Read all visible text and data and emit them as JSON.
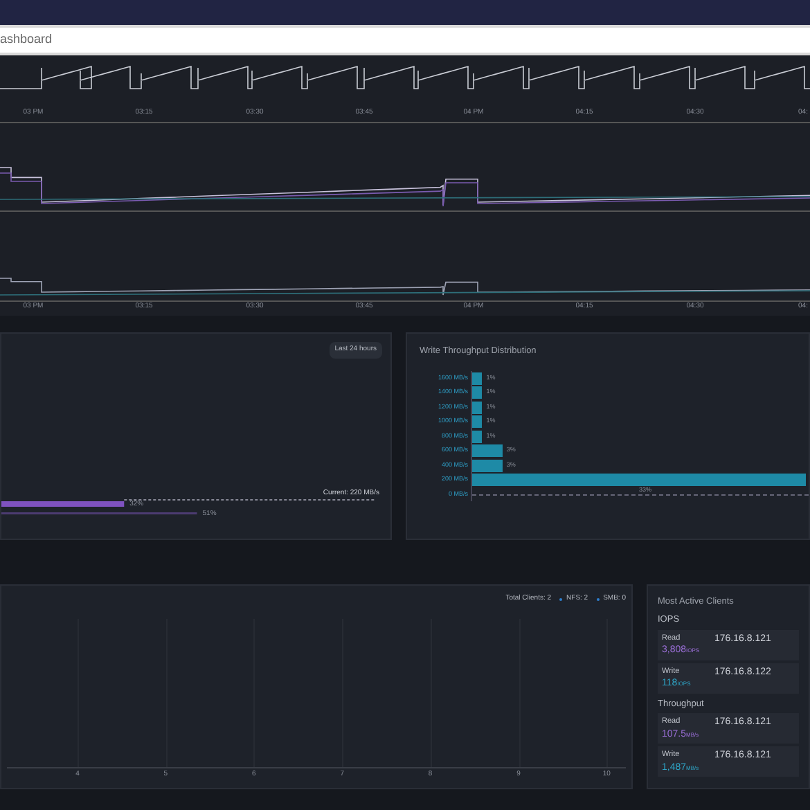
{
  "address_bar": {
    "value": "ashboard"
  },
  "timeline": {
    "top_axis": [
      "03 PM",
      "03:15",
      "03:30",
      "03:45",
      "04 PM",
      "04:15",
      "04:30",
      "04:"
    ],
    "bottom_axis": [
      "03 PM",
      "03:15",
      "03:30",
      "03:45",
      "04 PM",
      "04:15",
      "04:30",
      "04:"
    ]
  },
  "distribution_panel": {
    "range_button": "Last 24 hours",
    "current_label": "Current: 220 MB/s",
    "bars": [
      {
        "level": 0.32,
        "reading": "32%"
      },
      {
        "level": 0.51,
        "reading": "51%"
      }
    ]
  },
  "write_distribution": {
    "chart_data": {
      "type": "bar",
      "orientation": "horizontal",
      "title": "Write Throughput Distribution",
      "categories": [
        "1600 MB/s",
        "1400 MB/s",
        "1200 MB/s",
        "1000 MB/s",
        "800 MB/s",
        "600 MB/s",
        "400 MB/s",
        "200 MB/s",
        "0 MB/s"
      ],
      "values": [
        1,
        1,
        1,
        1,
        1,
        3,
        3,
        33,
        null
      ],
      "value_labels": [
        "1%",
        "1%",
        "1%",
        "1%",
        "1%",
        "3%",
        "3%",
        "33%",
        null
      ]
    }
  },
  "clients_panel": {
    "total": "Total Clients: 2",
    "legend": [
      "NFS: 2",
      "SMB: 0"
    ],
    "x_ticks": [
      "4",
      "5",
      "6",
      "7",
      "8",
      "9",
      "10"
    ]
  },
  "active_clients": {
    "title": "Most Active Clients",
    "groups": [
      {
        "title": "IOPS",
        "rows": [
          {
            "kind": "read",
            "label": "Read",
            "value": "3,808",
            "unit": "IOPS",
            "client": "176.16.8.121"
          },
          {
            "kind": "write",
            "label": "Write",
            "value": "118",
            "unit": "IOPS",
            "client": "176.16.8.122"
          }
        ]
      },
      {
        "title": "Throughput",
        "rows": [
          {
            "kind": "read",
            "label": "Read",
            "value": "107.5",
            "unit": "MB/s",
            "client": "176.16.8.121"
          },
          {
            "kind": "write",
            "label": "Write",
            "value": "1,487",
            "unit": "MB/s",
            "client": "176.16.8.121"
          }
        ]
      }
    ]
  }
}
